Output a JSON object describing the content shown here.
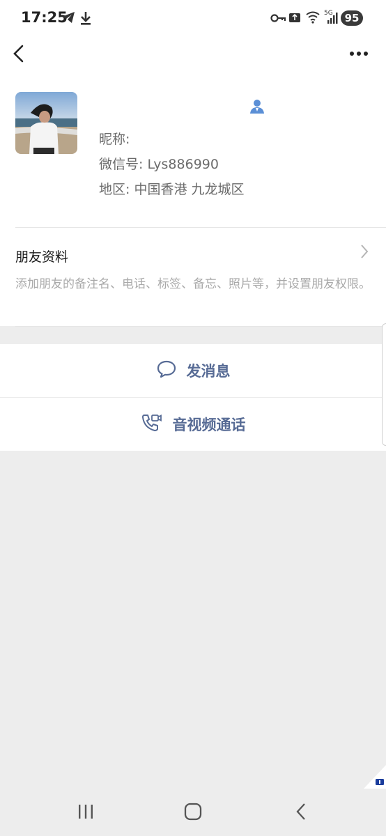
{
  "status_bar": {
    "time": "17:25",
    "network": "5G",
    "battery": "95"
  },
  "header": {
    "back_icon": "chevron-left-icon",
    "more_icon": "more-horizontal-icon"
  },
  "profile": {
    "nickname_label": "昵称:",
    "wechat_id_line": "微信号: Lys886990",
    "region_line": "地区: 中国香港  九龙城区",
    "contact_icon": "contact-person-icon",
    "accent_color": "#5b8fd6"
  },
  "friend_info": {
    "title": "朋友资料",
    "description": "添加朋友的备注名、电话、标签、备忘、照片等，并设置朋友权限。"
  },
  "actions": {
    "send_message": "发消息",
    "av_call": "音视频通话",
    "link_color": "#576b95"
  },
  "nav": {
    "recents": "recent-apps-icon",
    "home": "home-icon",
    "back": "back-icon"
  }
}
